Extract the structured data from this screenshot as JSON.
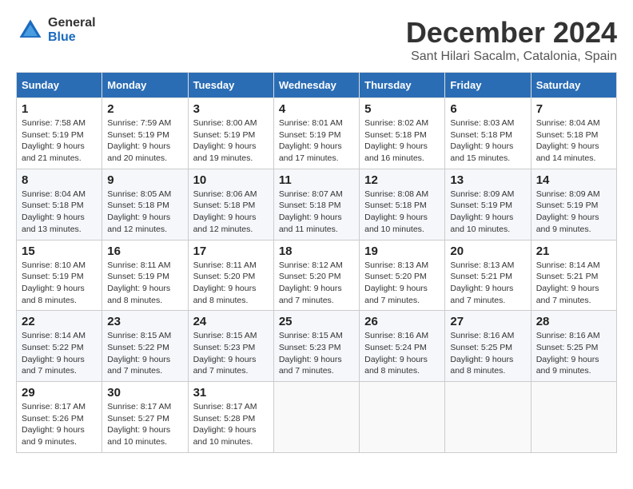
{
  "logo": {
    "line1": "General",
    "line2": "Blue"
  },
  "title": "December 2024",
  "subtitle": "Sant Hilari Sacalm, Catalonia, Spain",
  "headers": [
    "Sunday",
    "Monday",
    "Tuesday",
    "Wednesday",
    "Thursday",
    "Friday",
    "Saturday"
  ],
  "weeks": [
    [
      {
        "day": "1",
        "info": "Sunrise: 7:58 AM\nSunset: 5:19 PM\nDaylight: 9 hours and 21 minutes."
      },
      {
        "day": "2",
        "info": "Sunrise: 7:59 AM\nSunset: 5:19 PM\nDaylight: 9 hours and 20 minutes."
      },
      {
        "day": "3",
        "info": "Sunrise: 8:00 AM\nSunset: 5:19 PM\nDaylight: 9 hours and 19 minutes."
      },
      {
        "day": "4",
        "info": "Sunrise: 8:01 AM\nSunset: 5:19 PM\nDaylight: 9 hours and 17 minutes."
      },
      {
        "day": "5",
        "info": "Sunrise: 8:02 AM\nSunset: 5:18 PM\nDaylight: 9 hours and 16 minutes."
      },
      {
        "day": "6",
        "info": "Sunrise: 8:03 AM\nSunset: 5:18 PM\nDaylight: 9 hours and 15 minutes."
      },
      {
        "day": "7",
        "info": "Sunrise: 8:04 AM\nSunset: 5:18 PM\nDaylight: 9 hours and 14 minutes."
      }
    ],
    [
      {
        "day": "8",
        "info": "Sunrise: 8:04 AM\nSunset: 5:18 PM\nDaylight: 9 hours and 13 minutes."
      },
      {
        "day": "9",
        "info": "Sunrise: 8:05 AM\nSunset: 5:18 PM\nDaylight: 9 hours and 12 minutes."
      },
      {
        "day": "10",
        "info": "Sunrise: 8:06 AM\nSunset: 5:18 PM\nDaylight: 9 hours and 12 minutes."
      },
      {
        "day": "11",
        "info": "Sunrise: 8:07 AM\nSunset: 5:18 PM\nDaylight: 9 hours and 11 minutes."
      },
      {
        "day": "12",
        "info": "Sunrise: 8:08 AM\nSunset: 5:18 PM\nDaylight: 9 hours and 10 minutes."
      },
      {
        "day": "13",
        "info": "Sunrise: 8:09 AM\nSunset: 5:19 PM\nDaylight: 9 hours and 10 minutes."
      },
      {
        "day": "14",
        "info": "Sunrise: 8:09 AM\nSunset: 5:19 PM\nDaylight: 9 hours and 9 minutes."
      }
    ],
    [
      {
        "day": "15",
        "info": "Sunrise: 8:10 AM\nSunset: 5:19 PM\nDaylight: 9 hours and 8 minutes."
      },
      {
        "day": "16",
        "info": "Sunrise: 8:11 AM\nSunset: 5:19 PM\nDaylight: 9 hours and 8 minutes."
      },
      {
        "day": "17",
        "info": "Sunrise: 8:11 AM\nSunset: 5:20 PM\nDaylight: 9 hours and 8 minutes."
      },
      {
        "day": "18",
        "info": "Sunrise: 8:12 AM\nSunset: 5:20 PM\nDaylight: 9 hours and 7 minutes."
      },
      {
        "day": "19",
        "info": "Sunrise: 8:13 AM\nSunset: 5:20 PM\nDaylight: 9 hours and 7 minutes."
      },
      {
        "day": "20",
        "info": "Sunrise: 8:13 AM\nSunset: 5:21 PM\nDaylight: 9 hours and 7 minutes."
      },
      {
        "day": "21",
        "info": "Sunrise: 8:14 AM\nSunset: 5:21 PM\nDaylight: 9 hours and 7 minutes."
      }
    ],
    [
      {
        "day": "22",
        "info": "Sunrise: 8:14 AM\nSunset: 5:22 PM\nDaylight: 9 hours and 7 minutes."
      },
      {
        "day": "23",
        "info": "Sunrise: 8:15 AM\nSunset: 5:22 PM\nDaylight: 9 hours and 7 minutes."
      },
      {
        "day": "24",
        "info": "Sunrise: 8:15 AM\nSunset: 5:23 PM\nDaylight: 9 hours and 7 minutes."
      },
      {
        "day": "25",
        "info": "Sunrise: 8:15 AM\nSunset: 5:23 PM\nDaylight: 9 hours and 7 minutes."
      },
      {
        "day": "26",
        "info": "Sunrise: 8:16 AM\nSunset: 5:24 PM\nDaylight: 9 hours and 8 minutes."
      },
      {
        "day": "27",
        "info": "Sunrise: 8:16 AM\nSunset: 5:25 PM\nDaylight: 9 hours and 8 minutes."
      },
      {
        "day": "28",
        "info": "Sunrise: 8:16 AM\nSunset: 5:25 PM\nDaylight: 9 hours and 9 minutes."
      }
    ],
    [
      {
        "day": "29",
        "info": "Sunrise: 8:17 AM\nSunset: 5:26 PM\nDaylight: 9 hours and 9 minutes."
      },
      {
        "day": "30",
        "info": "Sunrise: 8:17 AM\nSunset: 5:27 PM\nDaylight: 9 hours and 10 minutes."
      },
      {
        "day": "31",
        "info": "Sunrise: 8:17 AM\nSunset: 5:28 PM\nDaylight: 9 hours and 10 minutes."
      },
      {
        "day": "",
        "info": ""
      },
      {
        "day": "",
        "info": ""
      },
      {
        "day": "",
        "info": ""
      },
      {
        "day": "",
        "info": ""
      }
    ]
  ]
}
